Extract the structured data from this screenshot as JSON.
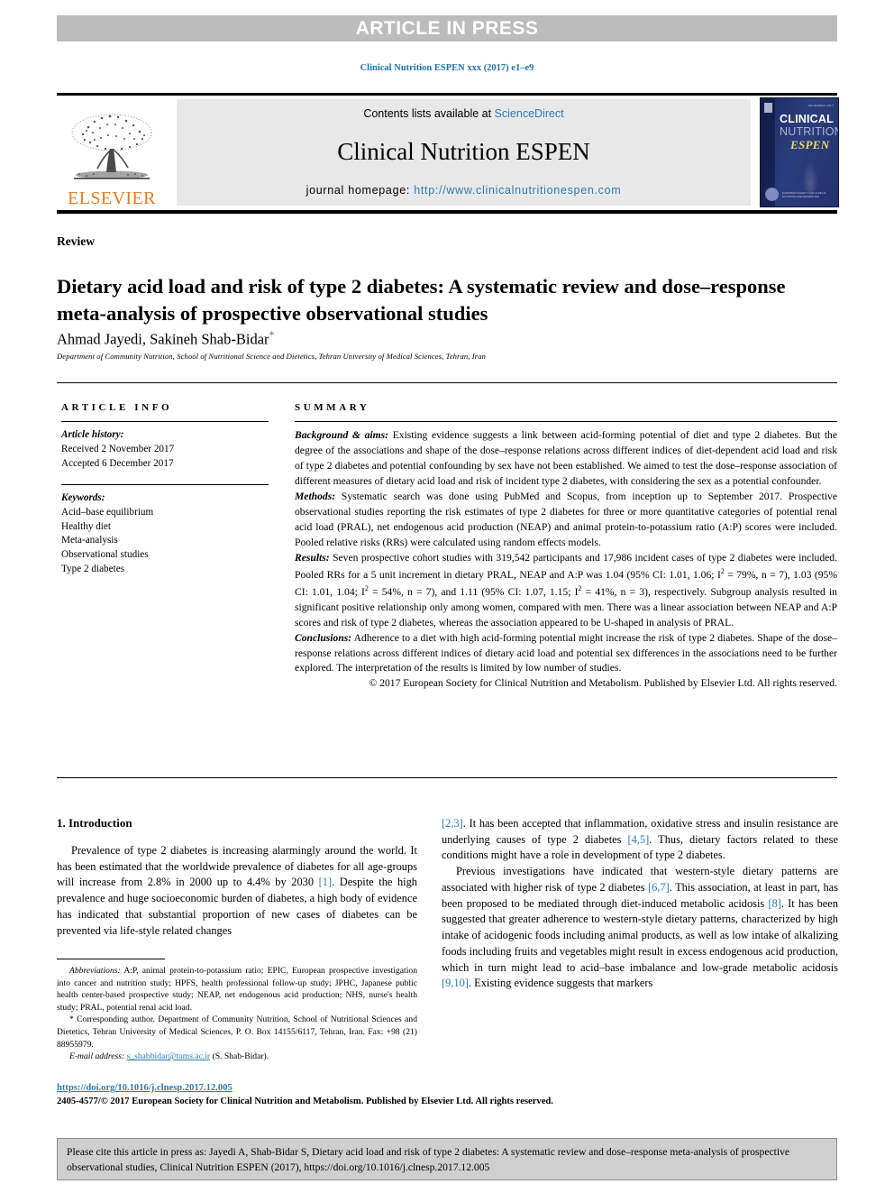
{
  "banner": {
    "text": "ARTICLE IN PRESS"
  },
  "running_head": {
    "citation": "Clinical Nutrition ESPEN xxx (2017) e1–e9"
  },
  "masthead": {
    "contents_prefix": "Contents lists available at ",
    "sciencedirect": "ScienceDirect",
    "journal_name": "Clinical Nutrition ESPEN",
    "homepage_label": "journal homepage: ",
    "homepage_url": "http://www.clinicalnutritionespen.com",
    "publisher": "ELSEVIER",
    "cover": {
      "line1": "CLINICAL",
      "line2": "NUTRITION",
      "line3": "ESPEN",
      "issue_tag": "DECEMBER 2017",
      "footer": "EUROPEAN SOCIETY FOR CLINICAL NUTRITION AND METABOLISM"
    }
  },
  "article": {
    "type": "Review",
    "title": "Dietary acid load and risk of type 2 diabetes: A systematic review and dose–response meta-analysis of prospective observational studies",
    "authors": "Ahmad Jayedi, Sakineh Shab-Bidar",
    "corresponding_marker": "*",
    "affiliation": "Department of Community Nutrition, School of Nutritional Science and Dietetics, Tehran University of Medical Sciences, Tehran, Iran"
  },
  "article_info": {
    "heading": "ARTICLE INFO",
    "history_label": "Article history:",
    "received": "Received 2 November 2017",
    "accepted": "Accepted 6 December 2017",
    "keywords_label": "Keywords:",
    "keywords": [
      "Acid–base equilibrium",
      "Healthy diet",
      "Meta-analysis",
      "Observational studies",
      "Type 2 diabetes"
    ]
  },
  "summary": {
    "heading": "SUMMARY",
    "background_label": "Background & aims:",
    "background_text": " Existing evidence suggests a link between acid-forming potential of diet and type 2 diabetes. But the degree of the associations and shape of the dose–response relations across different indices of diet-dependent acid load and risk of type 2 diabetes and potential confounding by sex have not been established. We aimed to test the dose–response association of different measures of dietary acid load and risk of incident type 2 diabetes, with considering the sex as a potential confounder.",
    "methods_label": "Methods:",
    "methods_text": " Systematic search was done using PubMed and Scopus, from inception up to September 2017. Prospective observational studies reporting the risk estimates of type 2 diabetes for three or more quantitative categories of potential renal acid load (PRAL), net endogenous acid production (NEAP) and animal protein-to-potassium ratio (A:P) scores were included. Pooled relative risks (RRs) were calculated using random effects models.",
    "results_label": "Results:",
    "results_text_1": " Seven prospective cohort studies with 319,542 participants and 17,986 incident cases of type 2 diabetes were included. Pooled RRs for a 5 unit increment in dietary PRAL, NEAP and A:P was 1.04 (95% CI: 1.01, 1.06; I",
    "results_text_2": " = 79%, n = 7), 1.03 (95% CI: 1.01, 1.04; I",
    "results_text_3": " = 54%, n = 7), and 1.11 (95% CI: 1.07, 1.15; I",
    "results_text_4": " = 41%, n = 3), respectively. Subgroup analysis resulted in significant positive relationship only among women, compared with men. There was a linear association between NEAP and A:P scores and risk of type 2 diabetes, whereas the association appeared to be U-shaped in analysis of PRAL.",
    "superscript_2": "2",
    "conclusions_label": "Conclusions:",
    "conclusions_text": " Adherence to a diet with high acid-forming potential might increase the risk of type 2 diabetes. Shape of the dose–response relations across different indices of dietary acid load and potential sex differences in the associations need to be further explored. The interpretation of the results is limited by low number of studies.",
    "copyright": "© 2017 European Society for Clinical Nutrition and Metabolism. Published by Elsevier Ltd. All rights reserved."
  },
  "introduction": {
    "heading": "1. Introduction",
    "para1_a": "Prevalence of type 2 diabetes is increasing alarmingly around the world. It has been estimated that the worldwide prevalence of diabetes for all age-groups will increase from 2.8% in 2000 up to 4.4% by 2030 ",
    "ref1": "[1]",
    "para1_b": ". Despite the high prevalence and huge socioeconomic burden of diabetes, a high body of evidence has indicated that substantial proportion of new cases of diabetes can be prevented via life-style related changes ",
    "ref23": "[2,3]",
    "para1_c": ". It has been accepted that inflammation, oxidative stress and insulin resistance are underlying causes of type 2 diabetes ",
    "ref45": "[4,5]",
    "para1_d": ". Thus, dietary factors related to these conditions might have a role in development of type 2 diabetes.",
    "para2_a": "Previous investigations have indicated that western-style dietary patterns are associated with higher risk of type 2 diabetes ",
    "ref67": "[6,7]",
    "para2_b": ". This association, at least in part, has been proposed to be mediated through diet-induced metabolic acidosis ",
    "ref8": "[8]",
    "para2_c": ". It has been suggested that greater adherence to western-style dietary patterns, characterized by high intake of acidogenic foods including animal products, as well as low intake of alkalizing foods including fruits and vegetables might result in excess endogenous acid production, which in turn might lead to acid–base imbalance and low-grade metabolic acidosis ",
    "ref910": "[9,10]",
    "para2_d": ". Existing evidence suggests that markers"
  },
  "footnotes": {
    "abbreviations_label": "Abbreviations:",
    "abbreviations_text": " A:P, animal protein-to-potassium ratio; EPIC, European prospective investigation into cancer and nutrition study; HPFS, health professional follow-up study; JPHC, Japanese public health center-based prospective study; NEAP, net endogenous acid production; NHS, nurse's health study; PRAL, potential renal acid load.",
    "corresponding_marker": "*",
    "corresponding_text": " Corresponding author. Department of Community Nutrition, School of Nutritional Sciences and Dietetics, Tehran University of Medical Sciences, P. O. Box 14155/6117, Tehran, Iran. Fax: +98 (21) 88955979.",
    "email_label": "E-mail address:",
    "email": "s_shabbidar@tums.ac.ir",
    "email_suffix": " (S. Shab-Bidar)."
  },
  "doi_block": {
    "doi": "https://doi.org/10.1016/j.clnesp.2017.12.005",
    "issn_copyright": "2405-4577/© 2017 European Society for Clinical Nutrition and Metabolism. Published by Elsevier Ltd. All rights reserved."
  },
  "cite_box": {
    "text": "Please cite this article in press as: Jayedi A, Shab-Bidar S, Dietary acid load and risk of type 2 diabetes: A systematic review and dose–response meta-analysis of prospective observational studies, Clinical Nutrition ESPEN (2017), https://doi.org/10.1016/j.clnesp.2017.12.005"
  },
  "colors": {
    "link": "#2b7ab5",
    "banner_bg": "#bcbcbc",
    "masthead_bg": "#e8e8e8",
    "elsevier_orange": "#e87b1e",
    "cite_box_bg": "#cfcfcf",
    "cover_blue": "#24326c"
  }
}
